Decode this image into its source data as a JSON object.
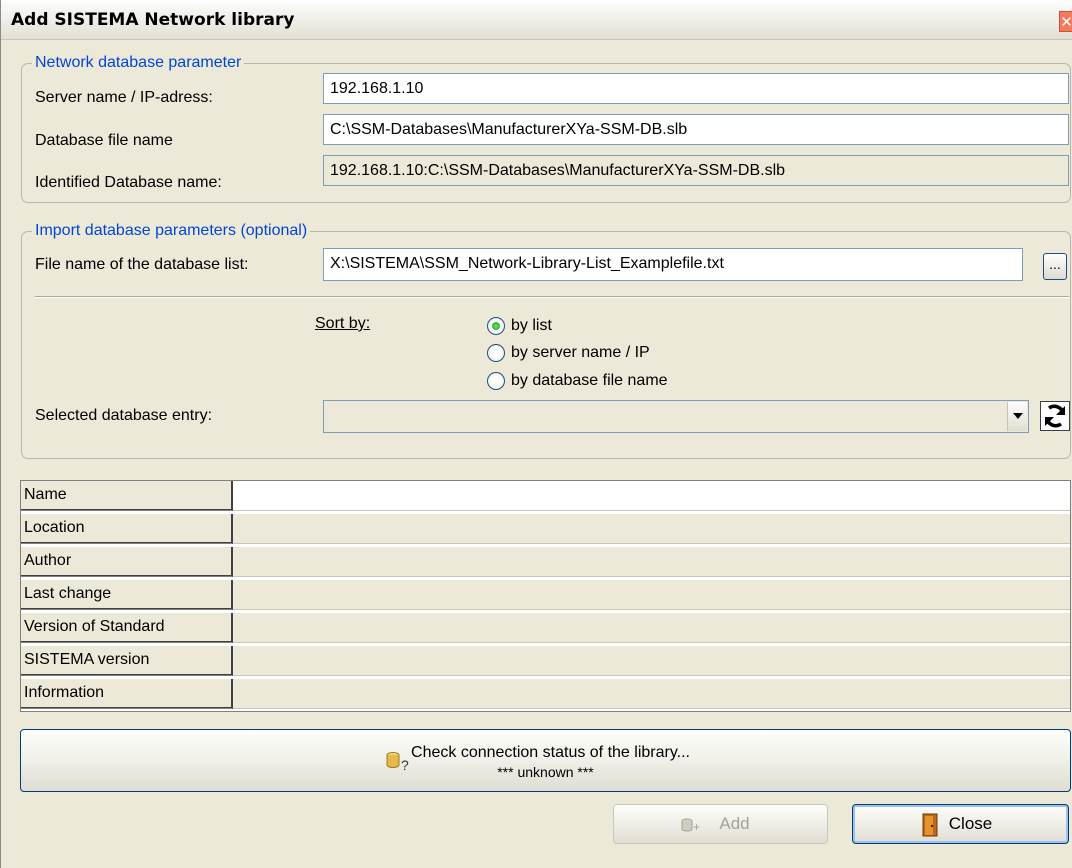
{
  "window": {
    "title": "Add SISTEMA Network library",
    "close_glyph": "✕"
  },
  "network_group": {
    "legend": "Network database parameter",
    "server_label": "Server name / IP-adress:",
    "server_value": "192.168.1.10",
    "dbfile_label": "Database file name",
    "dbfile_value": "C:\\SSM-Databases\\ManufacturerXYa-SSM-DB.slb",
    "identified_label": "Identified Database name:",
    "identified_value": "192.168.1.10:C:\\SSM-Databases\\ManufacturerXYa-SSM-DB.slb"
  },
  "import_group": {
    "legend": "Import database parameters (optional)",
    "listfile_label": "File name of the database list:",
    "listfile_value": "X:\\SISTEMA\\SSM_Network-Library-List_Examplefile.txt",
    "browse_label": "...",
    "sort_label": "Sort by:",
    "sort_options": [
      "by list",
      "by server name / IP",
      "by database file name"
    ],
    "sort_selected": "by list",
    "selected_entry_label": "Selected database entry:",
    "selected_entry_value": ""
  },
  "properties": {
    "rows": [
      {
        "label": "Name",
        "value": ""
      },
      {
        "label": "Location",
        "value": ""
      },
      {
        "label": "Author",
        "value": ""
      },
      {
        "label": "Last change",
        "value": ""
      },
      {
        "label": "Version of Standard",
        "value": ""
      },
      {
        "label": "SISTEMA version",
        "value": ""
      },
      {
        "label": "Information",
        "value": ""
      }
    ]
  },
  "status_button": {
    "line1": "Check connection status of the library...",
    "line2": "*** unknown ***",
    "icon": "database-question-icon"
  },
  "footer": {
    "add_label": "Add",
    "add_icon": "database-add-icon",
    "close_label": "Close",
    "close_icon": "door-exit-icon"
  },
  "colors": {
    "legend_text": "#0046d5",
    "dialog_bg": "#ece9d8",
    "close_x": "#f37a5c"
  }
}
